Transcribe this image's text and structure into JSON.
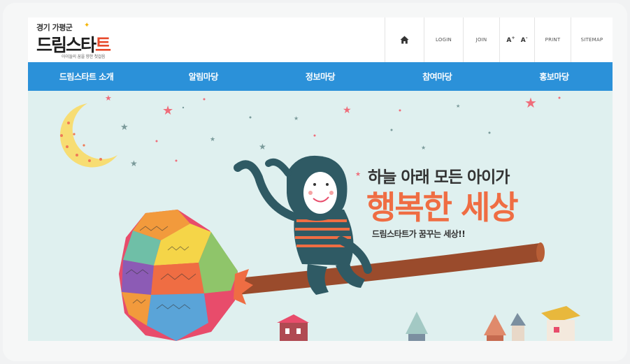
{
  "logo": {
    "region": "경기 가평군",
    "name_part1": "드림스타",
    "name_part2": "트",
    "tagline": "아이들의 꿈을 향한 첫걸음"
  },
  "utility": {
    "home_icon": "home-icon",
    "login": "LOGIN",
    "join": "JOIN",
    "font_up": "A",
    "font_up_sign": "+",
    "font_down": "A",
    "font_down_sign": "-",
    "print": "PRINT",
    "sitemap": "SITEMAP"
  },
  "nav": {
    "items": [
      "드림스타트 소개",
      "알림마당",
      "정보마당",
      "참여마당",
      "홍보마당"
    ]
  },
  "hero": {
    "line1": "하늘 아래 모든 아이가",
    "line2": "행복한 세상",
    "line3": "드림스타트가 꿈꾸는 세상!!"
  },
  "colors": {
    "nav_bg": "#2b91d9",
    "hero_bg": "#dff0ef",
    "accent": "#ef6d43"
  }
}
